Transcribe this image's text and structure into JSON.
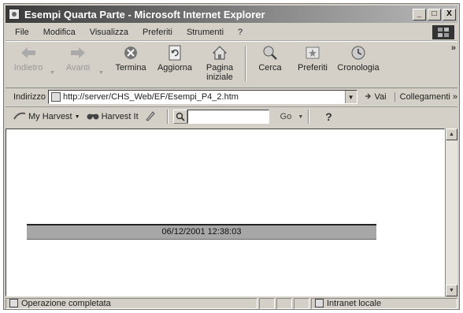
{
  "window": {
    "title": "Esempi Quarta Parte - Microsoft Internet Explorer",
    "controls": {
      "minimize": "_",
      "maximize": "□",
      "close": "X"
    }
  },
  "menu": {
    "items": [
      "File",
      "Modifica",
      "Visualizza",
      "Preferiti",
      "Strumenti",
      "?"
    ]
  },
  "toolbar": {
    "back_label": "Indietro",
    "forward_label": "Avanti",
    "stop_label": "Termina",
    "refresh_label": "Aggiorna",
    "home_label_line1": "Pagina",
    "home_label_line2": "iniziale",
    "search_label": "Cerca",
    "favorites_label": "Preferiti",
    "history_label": "Cronologia",
    "more": "»"
  },
  "address": {
    "label": "Indirizzo",
    "url": "http://server/CHS_Web/EF/Esempi_P4_2.htm",
    "go_label": "Vai",
    "links_label": "Collegamenti »"
  },
  "harvest": {
    "my_harvest_label": "My Harvest",
    "harvest_it_label": "Harvest It",
    "search_value": "",
    "go_label": "Go",
    "help_label": "?"
  },
  "page": {
    "datetime": "06/12/2001 12:38:03"
  },
  "status": {
    "message": "Operazione completata",
    "zone": "Intranet locale"
  }
}
